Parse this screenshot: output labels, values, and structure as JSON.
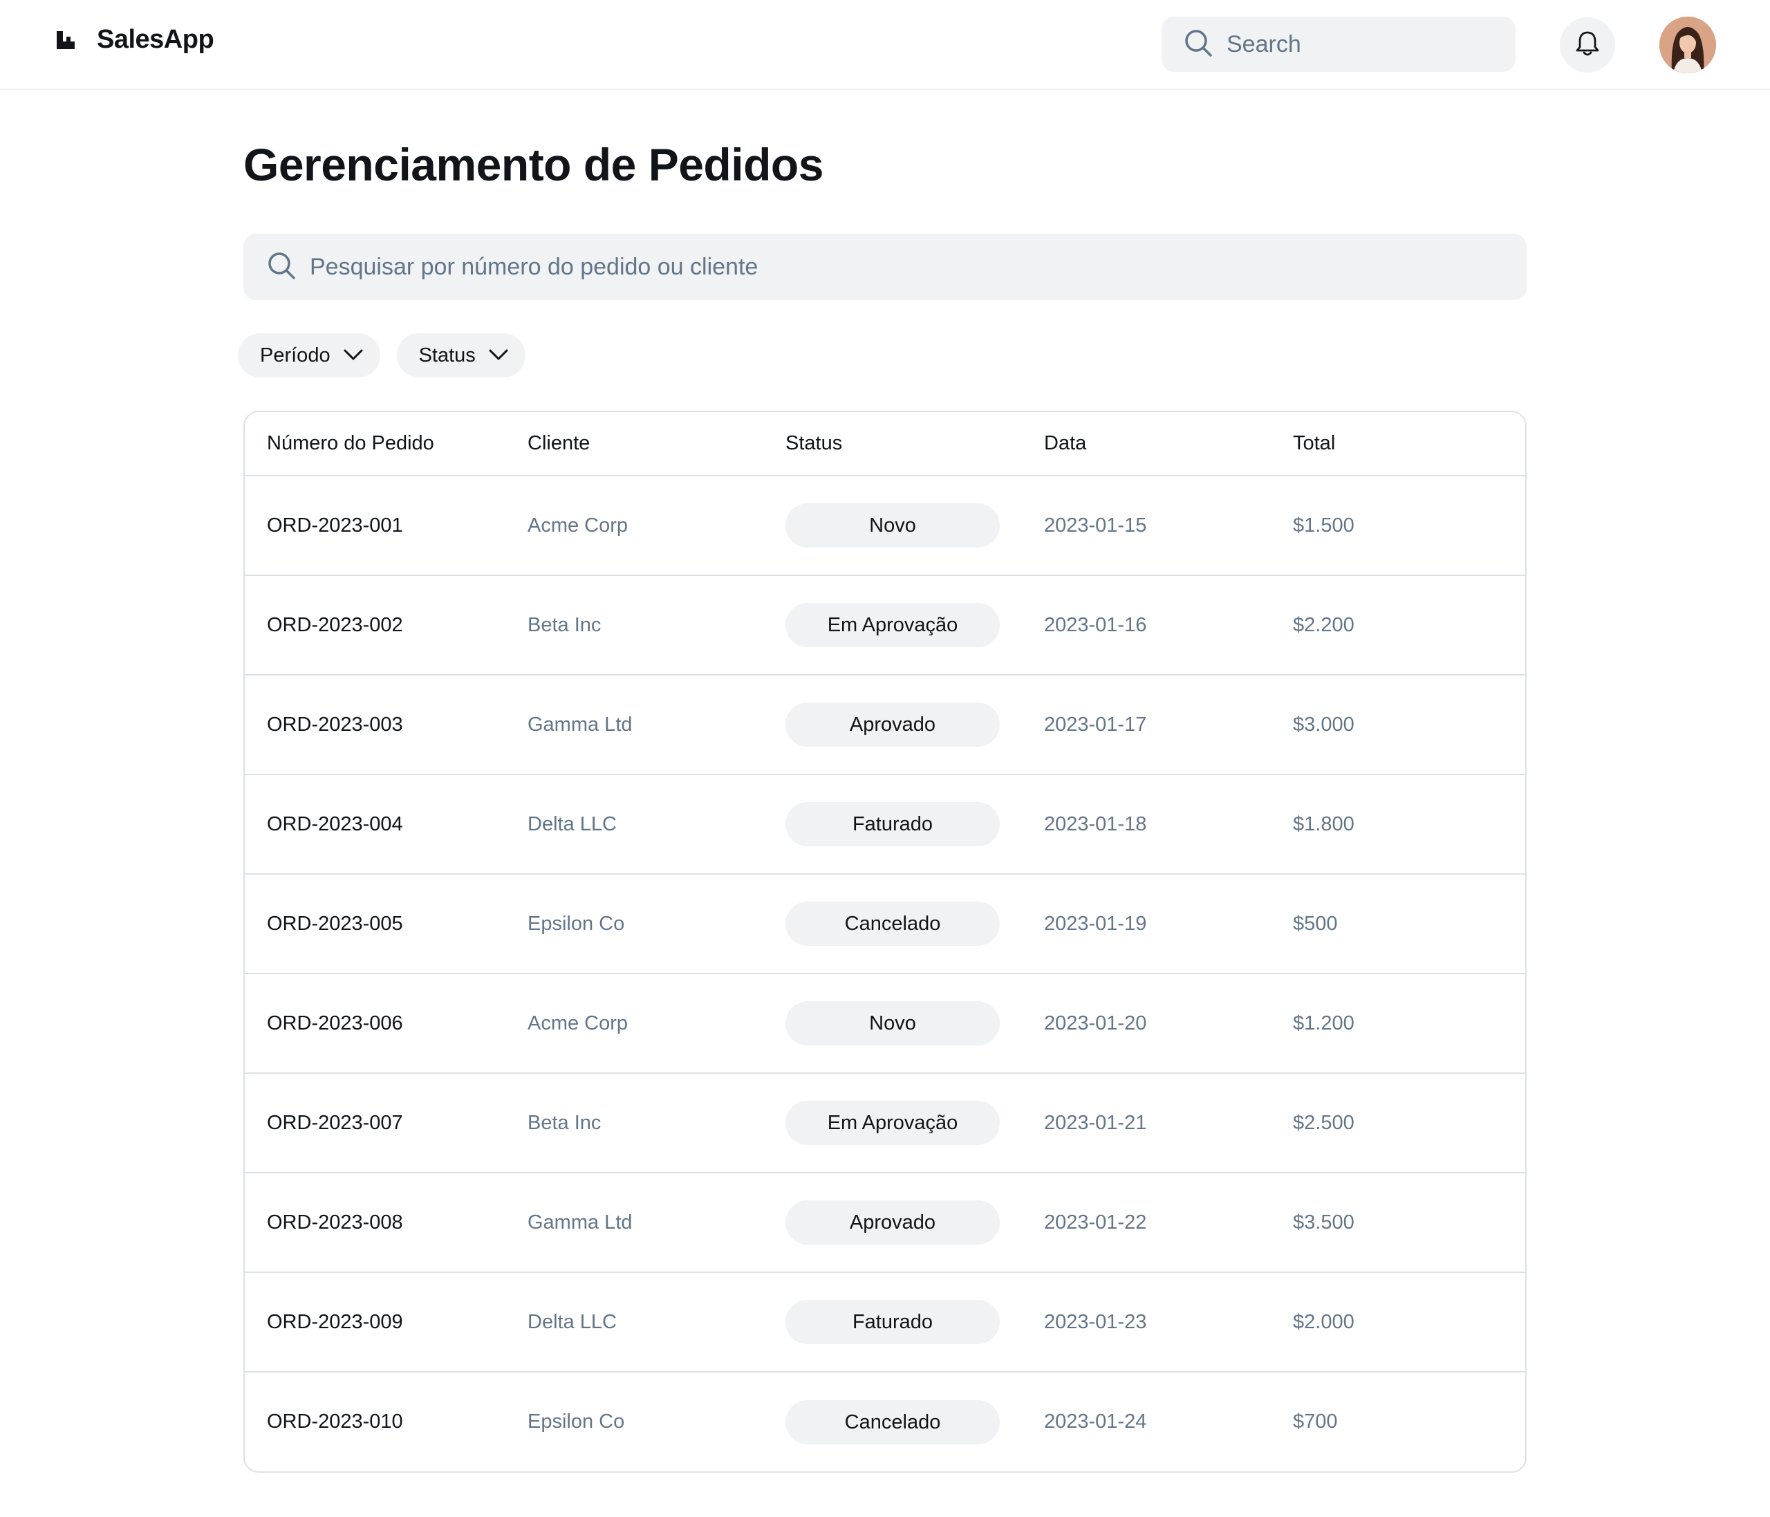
{
  "app": {
    "name": "SalesApp",
    "logo_icon": "logo-icon"
  },
  "header": {
    "search": {
      "placeholder": "Search",
      "icon": "search-icon"
    },
    "notifications_icon": "bell-icon",
    "avatar_icon": "user-avatar"
  },
  "main": {
    "title": "Gerenciamento de Pedidos",
    "search": {
      "placeholder": "Pesquisar por número do pedido ou cliente",
      "icon": "search-icon"
    },
    "filters": [
      {
        "label": "Período",
        "icon": "chevron-down-icon"
      },
      {
        "label": "Status",
        "icon": "chevron-down-icon"
      }
    ],
    "table": {
      "columns": [
        "Número do Pedido",
        "Cliente",
        "Status",
        "Data",
        "Total"
      ],
      "rows": [
        {
          "order": "ORD-2023-001",
          "client": "Acme Corp",
          "status": "Novo",
          "date": "2023-01-15",
          "total": "$1.500"
        },
        {
          "order": "ORD-2023-002",
          "client": "Beta Inc",
          "status": "Em Aprovação",
          "date": "2023-01-16",
          "total": "$2.200"
        },
        {
          "order": "ORD-2023-003",
          "client": "Gamma Ltd",
          "status": "Aprovado",
          "date": "2023-01-17",
          "total": "$3.000"
        },
        {
          "order": "ORD-2023-004",
          "client": "Delta LLC",
          "status": "Faturado",
          "date": "2023-01-18",
          "total": "$1.800"
        },
        {
          "order": "ORD-2023-005",
          "client": "Epsilon Co",
          "status": "Cancelado",
          "date": "2023-01-19",
          "total": "$500"
        },
        {
          "order": "ORD-2023-006",
          "client": "Acme Corp",
          "status": "Novo",
          "date": "2023-01-20",
          "total": "$1.200"
        },
        {
          "order": "ORD-2023-007",
          "client": "Beta Inc",
          "status": "Em Aprovação",
          "date": "2023-01-21",
          "total": "$2.500"
        },
        {
          "order": "ORD-2023-008",
          "client": "Gamma Ltd",
          "status": "Aprovado",
          "date": "2023-01-22",
          "total": "$3.500"
        },
        {
          "order": "ORD-2023-009",
          "client": "Delta LLC",
          "status": "Faturado",
          "date": "2023-01-23",
          "total": "$2.000"
        },
        {
          "order": "ORD-2023-010",
          "client": "Epsilon Co",
          "status": "Cancelado",
          "date": "2023-01-24",
          "total": "$700"
        }
      ]
    }
  },
  "colors": {
    "text_primary": "#111418",
    "text_secondary": "#637588",
    "surface": "#f0f2f4",
    "border": "#dde1e6"
  }
}
